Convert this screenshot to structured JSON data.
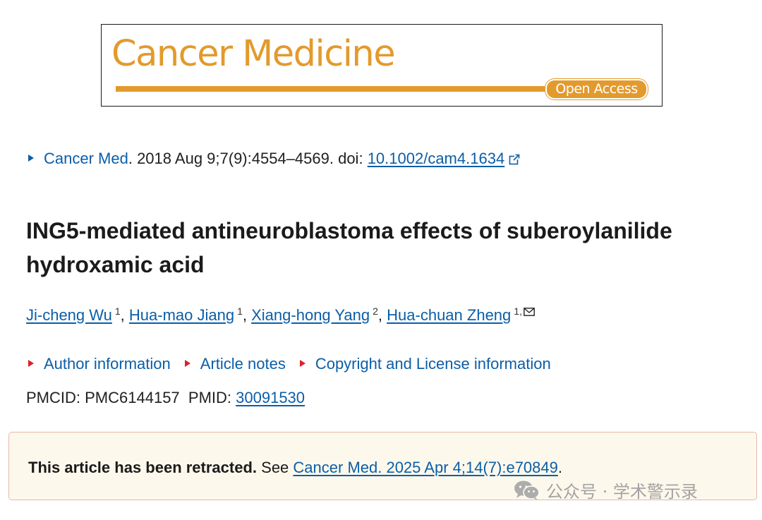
{
  "banner": {
    "title": "Cancer Medicine",
    "badge": "Open Access",
    "accent_color": "#e39a2c"
  },
  "citation": {
    "journal_link": "Cancer Med",
    "details": ". 2018 Aug 9;7(9):4554–4569. doi: ",
    "doi": "10.1002/cam4.1634",
    "icon": "external-link-icon"
  },
  "article": {
    "title": "ING5-mediated antineuroblastoma effects of suberoylanilide hydroxamic acid"
  },
  "authors": [
    {
      "name": "Ji-cheng Wu",
      "aff": "1"
    },
    {
      "name": "Hua-mao Jiang",
      "aff": "1"
    },
    {
      "name": "Xiang-hong Yang",
      "aff": "2"
    },
    {
      "name": "Hua-chuan Zheng",
      "aff": "1,"
    }
  ],
  "toggles": {
    "author_info": "Author information",
    "article_notes": "Article notes",
    "copyright": "Copyright and License information"
  },
  "ids": {
    "pmcid_label": "PMCID: ",
    "pmcid": "PMC6144157",
    "pmid_label": "PMID: ",
    "pmid": "30091530"
  },
  "notice": {
    "bold": "This article has been retracted.",
    "see": " See ",
    "link": "Cancer Med. 2025 Apr 4;14(7):e70849",
    "end": "."
  },
  "watermark": {
    "text": "公众号 · 学术警示录",
    "icon": "wechat-icon"
  },
  "colors": {
    "link": "#0b5ea8",
    "toggle_triangle": "#d8222a",
    "notice_bg": "#fdf8ec",
    "notice_border": "#e7b9a8"
  }
}
